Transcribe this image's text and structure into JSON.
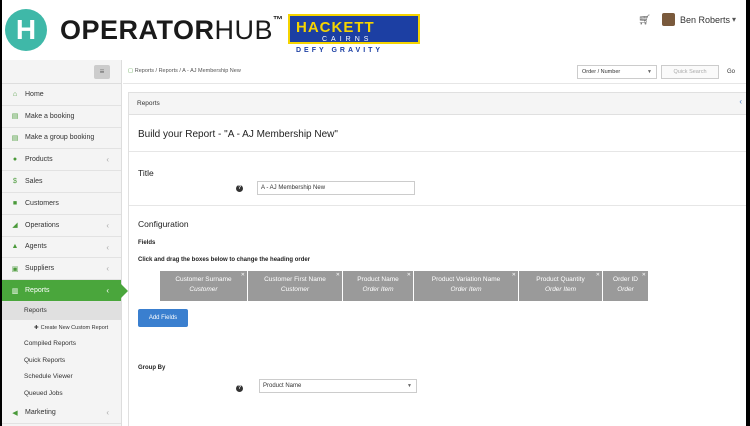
{
  "header": {
    "logo_letter": "H",
    "logo_operator": "OPERATOR",
    "logo_hub": "HUB",
    "logo_tm": "™",
    "partner_name": "HACKETT",
    "partner_sub": "CAIRNS",
    "partner_tagline": "DEFY GRAVITY",
    "user_name": "Ben Roberts"
  },
  "sidebar": {
    "items": [
      {
        "label": "Home",
        "icon": "home-icon",
        "glyph": "⌂",
        "chevron": false
      },
      {
        "label": "Make a booking",
        "icon": "cart-icon",
        "glyph": "▤",
        "chevron": false
      },
      {
        "label": "Make a group booking",
        "icon": "cart-icon",
        "glyph": "▤",
        "chevron": false
      },
      {
        "label": "Products",
        "icon": "tag-icon",
        "glyph": "●",
        "chevron": true
      },
      {
        "label": "Sales",
        "icon": "dollar-icon",
        "glyph": "$",
        "chevron": false
      },
      {
        "label": "Customers",
        "icon": "user-icon",
        "glyph": "■",
        "chevron": false
      },
      {
        "label": "Operations",
        "icon": "send-icon",
        "glyph": "◢",
        "chevron": true
      },
      {
        "label": "Agents",
        "icon": "sitemap-icon",
        "glyph": "▲",
        "chevron": true
      },
      {
        "label": "Suppliers",
        "icon": "building-icon",
        "glyph": "▣",
        "chevron": true
      },
      {
        "label": "Reports",
        "icon": "chart-icon",
        "glyph": "▥",
        "chevron": true
      }
    ],
    "sub_items": {
      "reports": "Reports",
      "create": "Create New Custom Report",
      "compiled": "Compiled Reports",
      "quick": "Quick Reports",
      "schedule": "Schedule Viewer",
      "queued": "Queued Jobs"
    },
    "last_item": "Marketing"
  },
  "breadcrumb": {
    "reports_link": "Reports",
    "rest": " / Reports / A - AJ Membership New"
  },
  "search": {
    "order_select": "Order / Number",
    "quick_search": "Quick Search",
    "go": "Go"
  },
  "panel": {
    "heading": "Reports",
    "page_title": "Build your Report - \"A - AJ Membership New\""
  },
  "title_section": {
    "heading": "Title",
    "value": "A - AJ Membership New"
  },
  "configuration": {
    "heading": "Configuration",
    "fields_label": "Fields",
    "instruction": "Click and drag the boxes below to change the heading order",
    "fields": [
      {
        "name": "Customer Surname",
        "source": "Customer"
      },
      {
        "name": "Customer First Name",
        "source": "Customer"
      },
      {
        "name": "Product Name",
        "source": "Order Item"
      },
      {
        "name": "Product Variation Name",
        "source": "Order Item"
      },
      {
        "name": "Product Quantity",
        "source": "Order Item"
      },
      {
        "name": "Order ID",
        "source": "Order"
      }
    ],
    "add_fields": "Add Fields"
  },
  "group_by": {
    "label": "Group By",
    "value": "Product Name"
  },
  "colors": {
    "accent_green": "#4aa63c",
    "primary_blue": "#3a7fcf",
    "logo_teal": "#3fb8a8"
  }
}
